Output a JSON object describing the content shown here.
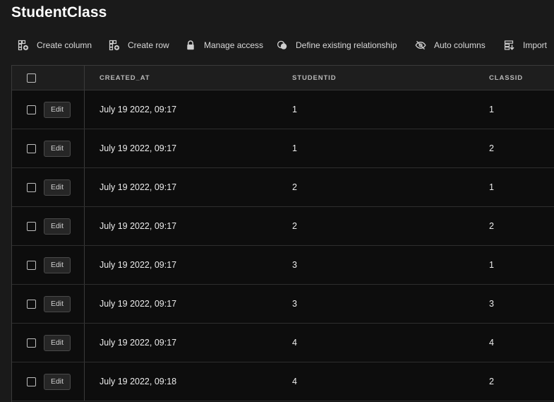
{
  "page": {
    "title": "StudentClass"
  },
  "toolbar": {
    "create_column": "Create column",
    "create_row": "Create row",
    "manage_access": "Manage access",
    "define_relationship": "Define existing relationship",
    "auto_columns": "Auto columns",
    "import": "Import"
  },
  "table": {
    "columns": {
      "created_at": "CREATED_AT",
      "studentid": "STUDENTID",
      "classid": "CLASSID"
    },
    "edit_label": "Edit",
    "rows": [
      {
        "created_at": "July 19 2022, 09:17",
        "studentid": "1",
        "classid": "1"
      },
      {
        "created_at": "July 19 2022, 09:17",
        "studentid": "1",
        "classid": "2"
      },
      {
        "created_at": "July 19 2022, 09:17",
        "studentid": "2",
        "classid": "1"
      },
      {
        "created_at": "July 19 2022, 09:17",
        "studentid": "2",
        "classid": "2"
      },
      {
        "created_at": "July 19 2022, 09:17",
        "studentid": "3",
        "classid": "1"
      },
      {
        "created_at": "July 19 2022, 09:17",
        "studentid": "3",
        "classid": "3"
      },
      {
        "created_at": "July 19 2022, 09:17",
        "studentid": "4",
        "classid": "4"
      },
      {
        "created_at": "July 19 2022, 09:18",
        "studentid": "4",
        "classid": "2"
      }
    ]
  },
  "colors": {
    "background": "#1a1a1a",
    "table_background": "#0d0d0d",
    "header_background": "#1e1e1e",
    "text": "#ececec"
  }
}
